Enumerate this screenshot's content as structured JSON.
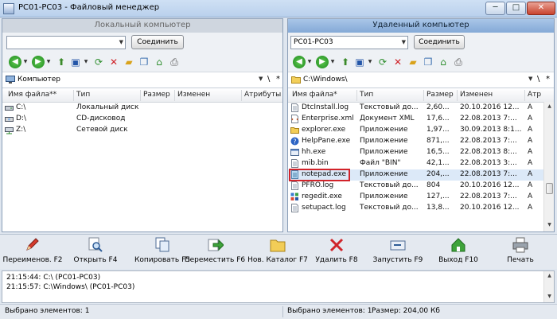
{
  "window": {
    "title": "PC01-PC03 - Файловый менеджер",
    "minimize_glyph": "─",
    "maximize_glyph": "□",
    "close_glyph": "✕"
  },
  "left_panel": {
    "header": "Локальный компьютер",
    "host_value": "",
    "connect_label": "Соединить",
    "path": "Компьютер",
    "path_sep": "\\",
    "path_asterisk": "*",
    "columns": [
      "Имя файла**",
      "Тип",
      "Размер",
      "Изменен",
      "Атрибуты"
    ],
    "rows": [
      {
        "icon": "local-drive-icon",
        "name": "C:\\",
        "type": "Локальный диск",
        "size": "",
        "modified": "",
        "attrs": ""
      },
      {
        "icon": "cd-drive-icon",
        "name": "D:\\",
        "type": "CD-дисковод",
        "size": "",
        "modified": "",
        "attrs": ""
      },
      {
        "icon": "network-drive-icon",
        "name": "Z:\\",
        "type": "Сетевой диск",
        "size": "",
        "modified": "",
        "attrs": ""
      }
    ]
  },
  "right_panel": {
    "header": "Удаленный компьютер",
    "host_value": "PC01-PC03",
    "connect_label": "Соединить",
    "path": "C:\\Windows\\",
    "path_sep": "\\",
    "path_asterisk": "*",
    "columns": [
      "Имя файла*",
      "Тип",
      "Размер",
      "Изменен",
      "Атр"
    ],
    "selected_index": 6,
    "rows": [
      {
        "icon": "file-icon",
        "name": "DtcInstall.log",
        "type": "Текстовый до...",
        "size": "2,60...",
        "modified": "20.10.2016 12...",
        "attrs": "A"
      },
      {
        "icon": "xml-file-icon",
        "name": "Enterprise.xml",
        "type": "Документ XML",
        "size": "17,6...",
        "modified": "22.08.2013 7:...",
        "attrs": "A"
      },
      {
        "icon": "folder-app-icon",
        "name": "explorer.exe",
        "type": "Приложение",
        "size": "1,97...",
        "modified": "30.09.2013 8:1...",
        "attrs": "A"
      },
      {
        "icon": "help-icon",
        "name": "HelpPane.exe",
        "type": "Приложение",
        "size": "871,...",
        "modified": "22.08.2013 7:...",
        "attrs": "A"
      },
      {
        "icon": "app-icon",
        "name": "hh.exe",
        "type": "Приложение",
        "size": "16,5...",
        "modified": "22.08.2013 8:...",
        "attrs": "A"
      },
      {
        "icon": "file-icon",
        "name": "mib.bin",
        "type": "Файл \"BIN\"",
        "size": "42,1...",
        "modified": "22.08.2013 3:...",
        "attrs": "A"
      },
      {
        "icon": "notepad-icon",
        "name": "notepad.exe",
        "type": "Приложение",
        "size": "204,...",
        "modified": "22.08.2013 7:...",
        "attrs": "A"
      },
      {
        "icon": "file-icon",
        "name": "PFRO.log",
        "type": "Текстовый до...",
        "size": "804",
        "modified": "20.10.2016 12...",
        "attrs": "A"
      },
      {
        "icon": "regedit-icon",
        "name": "regedit.exe",
        "type": "Приложение",
        "size": "127,...",
        "modified": "22.08.2013 7:...",
        "attrs": "A"
      },
      {
        "icon": "file-icon",
        "name": "setupact.log",
        "type": "Текстовый до...",
        "size": "13,8...",
        "modified": "20.10.2016 12...",
        "attrs": "A"
      }
    ]
  },
  "actions": [
    {
      "name": "rename",
      "label": "Переименов. F2",
      "icon": "pencil-icon"
    },
    {
      "name": "open",
      "label": "Открыть F4",
      "icon": "magnifier-icon"
    },
    {
      "name": "copy",
      "label": "Копировать F5",
      "icon": "copy-icon"
    },
    {
      "name": "move",
      "label": "Переместить F6",
      "icon": "move-icon"
    },
    {
      "name": "new-folder",
      "label": "Нов. Каталог F7",
      "icon": "folder-icon"
    },
    {
      "name": "delete",
      "label": "Удалить F8",
      "icon": "delete-icon"
    },
    {
      "name": "run",
      "label": "Запустить F9",
      "icon": "run-icon"
    },
    {
      "name": "exit",
      "label": "Выход F10",
      "icon": "exit-icon"
    },
    {
      "name": "print",
      "label": "Печать",
      "icon": "printer-icon"
    }
  ],
  "log": [
    "21:15:44: C:\\  (PC01-PC03)",
    "21:15:57: C:\\Windows\\  (PC01-PC03)"
  ],
  "status": {
    "left": "Выбрано элементов: 1",
    "right_selected": "Выбрано элементов: 1",
    "right_size": "Размер: 204,00 Кб"
  }
}
